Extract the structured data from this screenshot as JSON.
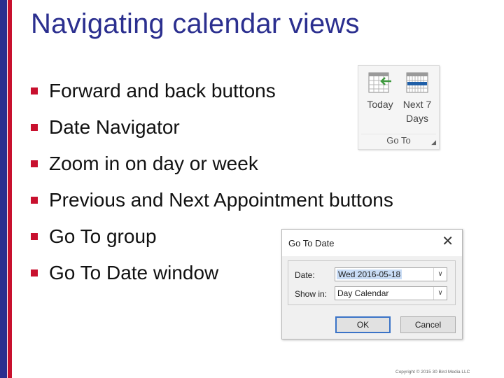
{
  "slide": {
    "title": "Navigating calendar views",
    "bullets": [
      "Forward and back buttons",
      "Date Navigator",
      "Zoom in on day or week",
      "Previous and Next Appointment buttons",
      "Go To group",
      "Go To Date window"
    ],
    "copyright": "Copyright © 2015 30 Bird Media LLC"
  },
  "ribbon": {
    "today_label": "Today",
    "next7_line1": "Next 7",
    "next7_line2": "Days",
    "group_label": "Go To"
  },
  "dialog": {
    "title": "Go To Date",
    "date_label": "Date:",
    "date_value": "Wed 2016-05-18",
    "show_label": "Show in:",
    "show_value": "Day Calendar",
    "ok_label": "OK",
    "cancel_label": "Cancel"
  },
  "colors": {
    "title_blue": "#2b2f8f",
    "bullet_red": "#c8102e",
    "icon_blue": "#1f5fa8",
    "icon_green": "#3f9a3f"
  }
}
